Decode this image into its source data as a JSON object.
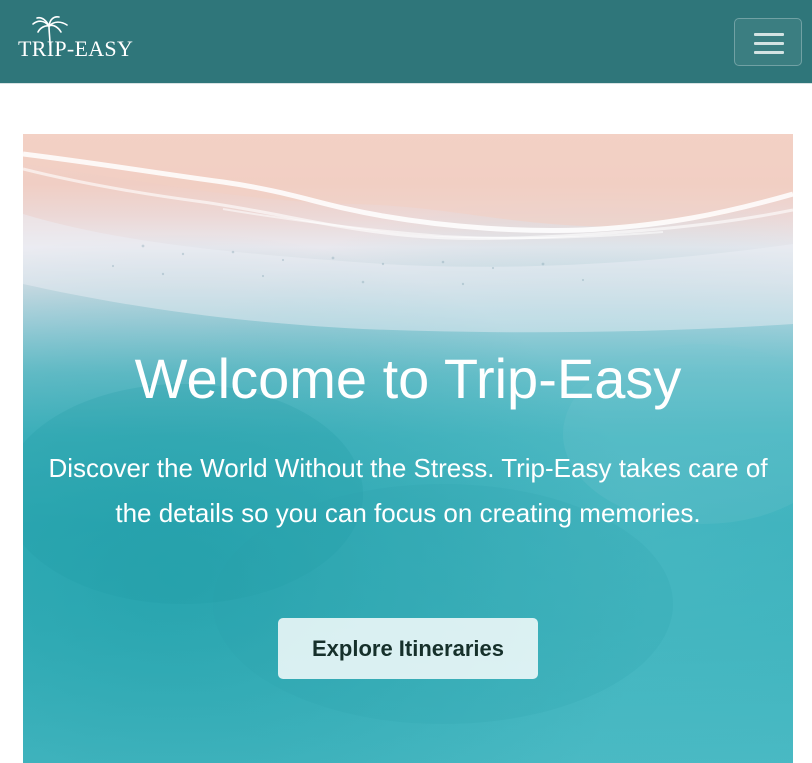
{
  "navbar": {
    "brand_text": "TRIP-EASY",
    "brand_icon": "palm-tree-icon",
    "menu_icon": "hamburger-menu-icon",
    "background_color": "#2f767a"
  },
  "hero": {
    "title": "Welcome to Trip-Easy",
    "subtitle": "Discover the World Without the Stress. Trip-Easy takes care of the details so you can focus on creating memories.",
    "cta_label": "Explore Itineraries",
    "image_subject": "aerial-beach-ocean-background"
  }
}
